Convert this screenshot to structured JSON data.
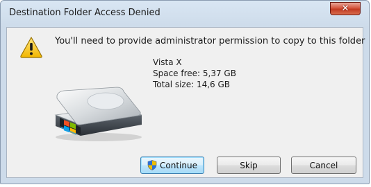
{
  "window": {
    "title": "Destination Folder Access Denied"
  },
  "dialog": {
    "message": "You'll need to provide administrator permission to copy to this folder",
    "drive": {
      "name": "Vista X",
      "space_free": "Space free: 5,37 GB",
      "total_size": "Total size: 14,6 GB"
    }
  },
  "buttons": {
    "continue_label": "Continue",
    "skip_label": "Skip",
    "cancel_label": "Cancel"
  },
  "icons": {
    "warning": "warning-icon",
    "drive": "hard-drive-icon",
    "shield": "uac-shield-icon",
    "close": "close-icon"
  },
  "colors": {
    "close_button": "#c23b22",
    "default_button": "#3c7fb1"
  }
}
